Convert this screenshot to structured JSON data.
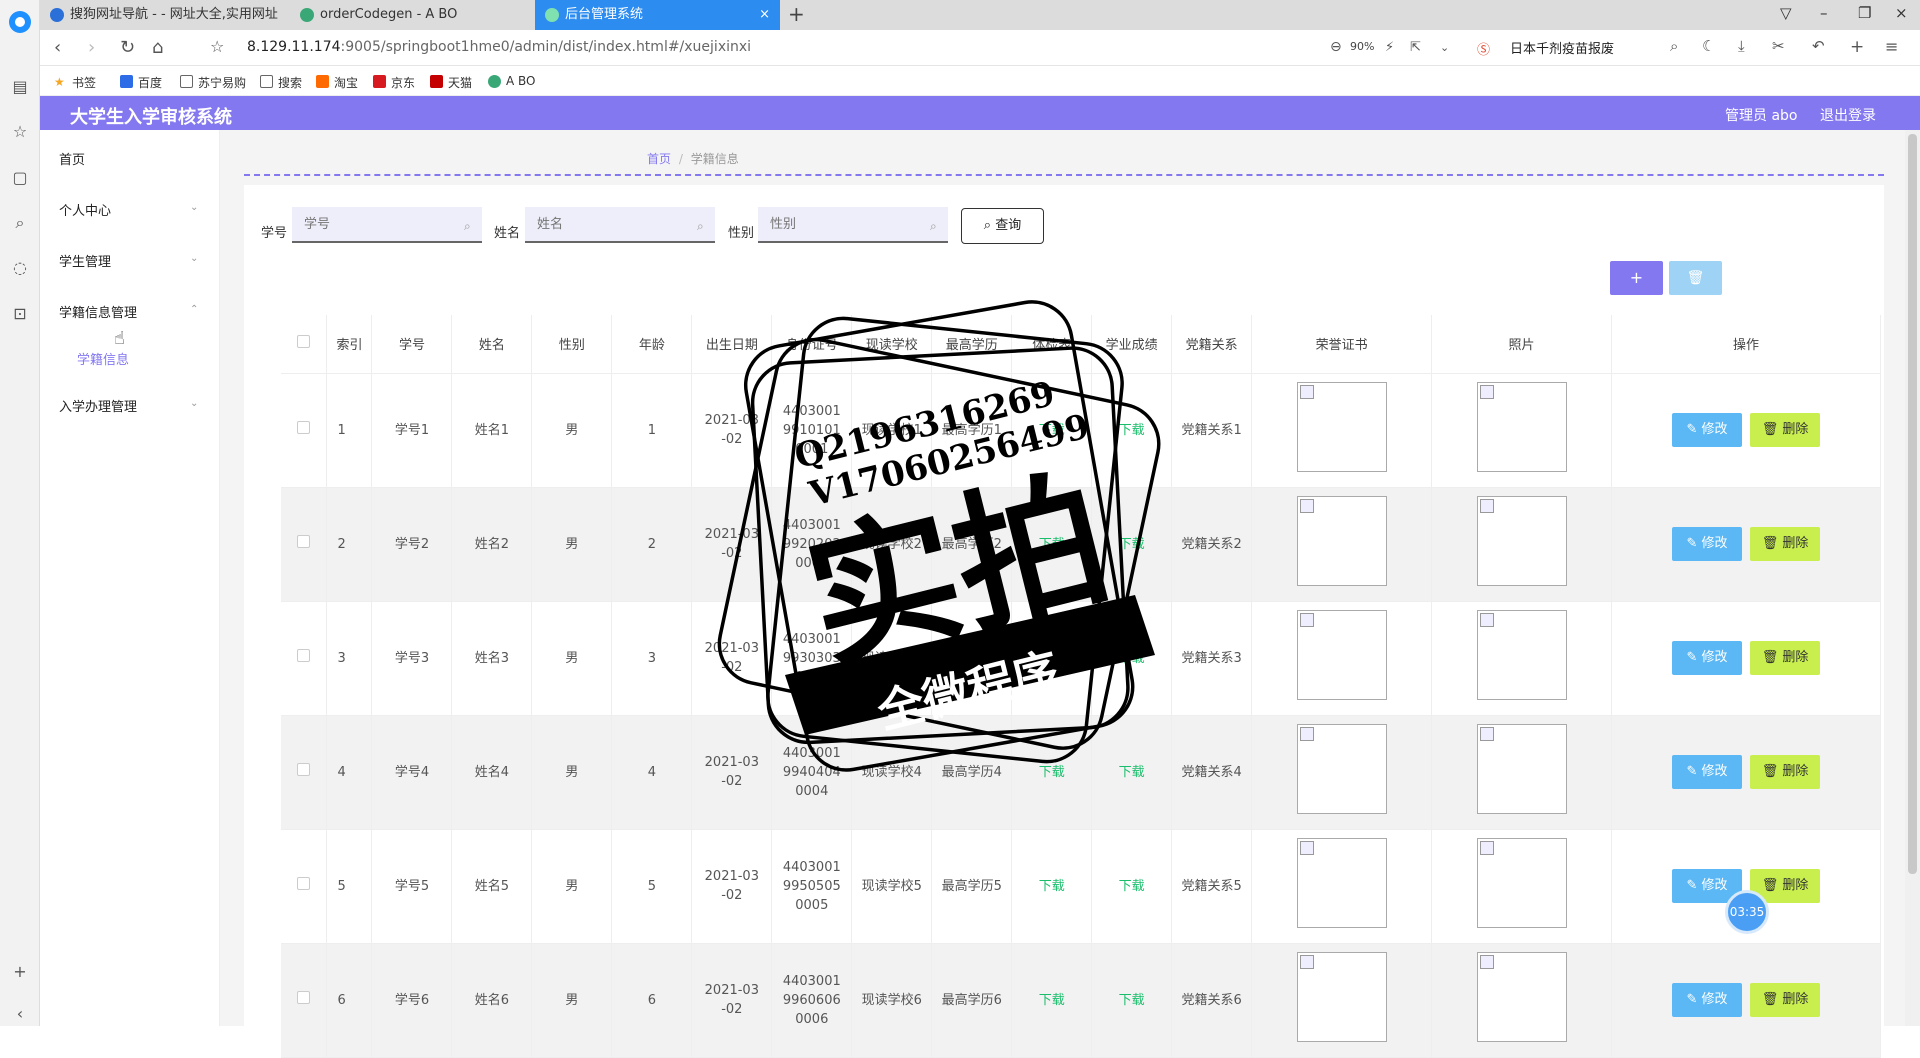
{
  "browser": {
    "tabs": [
      {
        "label": "搜狗网址导航 - - 网址大全,实用网址"
      },
      {
        "label": "orderCodegen - A BO"
      },
      {
        "label": "后台管理系统",
        "active": true
      }
    ],
    "url_host": "8.129.11.174",
    "url_path": ":9005/springboot1hme0/admin/dist/index.html#/xuejixinxi",
    "zoom": "90%",
    "search_text": "日本千剂疫苗报废",
    "bookmarks": [
      "书签",
      "百度",
      "苏宁易购",
      "搜索",
      "淘宝",
      "京东",
      "天猫",
      "A BO"
    ]
  },
  "app": {
    "title": "大学生入学审核系统",
    "user": "管理员 abo",
    "logout": "退出登录"
  },
  "sidebar": {
    "items": [
      {
        "label": "首页"
      },
      {
        "label": "个人中心"
      },
      {
        "label": "学生管理"
      },
      {
        "label": "学籍信息管理"
      },
      {
        "label": "入学办理管理"
      }
    ],
    "sub_item": "学籍信息"
  },
  "breadcrumb": {
    "home": "首页",
    "sep": "/",
    "current": "学籍信息"
  },
  "filters": {
    "xuehao_label": "学号",
    "xuehao_placeholder": "学号",
    "xingming_label": "姓名",
    "xingming_placeholder": "姓名",
    "xingbie_label": "性别",
    "xingbie_placeholder": "性别",
    "query_button": "查询"
  },
  "toolbar": {
    "add": "+",
    "delete": "🗑"
  },
  "table": {
    "headers": [
      "索引",
      "学号",
      "姓名",
      "性别",
      "年龄",
      "出生日期",
      "身份证号",
      "现读学校",
      "最高学历",
      "体检表",
      "学业成绩",
      "党籍关系",
      "荣誉证书",
      "照片",
      "操作"
    ],
    "rows": [
      {
        "index": "1",
        "xuehao": "学号1",
        "xingming": "姓名1",
        "xingbie": "男",
        "age": "1",
        "birth": "2021-03-02",
        "idcard": "440300199101010001",
        "school": "现读学校1",
        "edu": "最高学历1",
        "tijian": "下载",
        "chengji": "下载",
        "dangji": "党籍关系1"
      },
      {
        "index": "2",
        "xuehao": "学号2",
        "xingming": "姓名2",
        "xingbie": "男",
        "age": "2",
        "birth": "2021-03-02",
        "idcard": "440300199202020002",
        "school": "现读学校2",
        "edu": "最高学历2",
        "tijian": "下载",
        "chengji": "下载",
        "dangji": "党籍关系2"
      },
      {
        "index": "3",
        "xuehao": "学号3",
        "xingming": "姓名3",
        "xingbie": "男",
        "age": "3",
        "birth": "2021-03-02",
        "idcard": "440300199303030003",
        "school": "现读学校3",
        "edu": "最高学历3",
        "tijian": "下载",
        "chengji": "下载",
        "dangji": "党籍关系3"
      },
      {
        "index": "4",
        "xuehao": "学号4",
        "xingming": "姓名4",
        "xingbie": "男",
        "age": "4",
        "birth": "2021-03-02",
        "idcard": "440300199404040004",
        "school": "现读学校4",
        "edu": "最高学历4",
        "tijian": "下载",
        "chengji": "下载",
        "dangji": "党籍关系4"
      },
      {
        "index": "5",
        "xuehao": "学号5",
        "xingming": "姓名5",
        "xingbie": "男",
        "age": "5",
        "birth": "2021-03-02",
        "idcard": "440300199505050005",
        "school": "现读学校5",
        "edu": "最高学历5",
        "tijian": "下载",
        "chengji": "下载",
        "dangji": "党籍关系5"
      },
      {
        "index": "6",
        "xuehao": "学号6",
        "xingming": "姓名6",
        "xingbie": "男",
        "age": "6",
        "birth": "2021-03-02",
        "idcard": "440300199606060006",
        "school": "现读学校6",
        "edu": "最高学历6",
        "tijian": "下载",
        "chengji": "下载",
        "dangji": "党籍关系6"
      }
    ],
    "edit_label": "修改",
    "delete_label": "删除"
  },
  "watermark": {
    "line1": "Q2196316269",
    "line2": "V17060256499",
    "big": "实拍",
    "ribbon": "全微程序"
  },
  "timer": "03:35",
  "colors": {
    "accent": "#8478f0",
    "edit": "#5bb8f5",
    "delete": "#c8ef4e",
    "download": "#19be6b"
  }
}
